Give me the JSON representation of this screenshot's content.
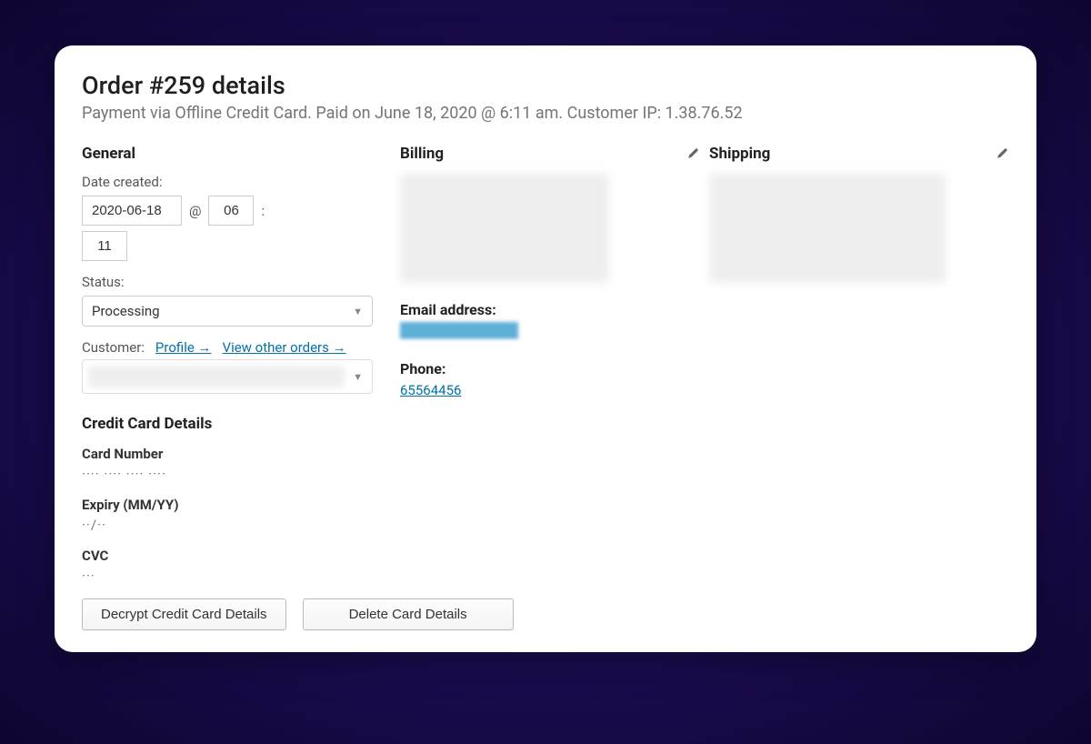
{
  "header": {
    "title": "Order #259 details",
    "subtitle": "Payment via Offline Credit Card. Paid on June 18, 2020 @ 6:11 am. Customer IP: 1.38.76.52"
  },
  "general": {
    "title": "General",
    "date_created_label": "Date created:",
    "date_value": "2020-06-18",
    "at_symbol": "@",
    "hour_value": "06",
    "colon": ":",
    "minute_value": "11",
    "status_label": "Status:",
    "status_value": "Processing",
    "customer_label": "Customer:",
    "profile_link": "Profile →",
    "view_orders_link": "View other orders →"
  },
  "billing": {
    "title": "Billing",
    "email_label": "Email address:",
    "phone_label": "Phone:",
    "phone_value": "65564456"
  },
  "shipping": {
    "title": "Shipping"
  },
  "credit_card": {
    "title": "Credit Card Details",
    "card_number_label": "Card Number",
    "card_number_value": "···· ···· ···· ····",
    "expiry_label": "Expiry (MM/YY)",
    "expiry_value": "··/··",
    "cvc_label": "CVC",
    "cvc_value": "···",
    "decrypt_button": "Decrypt Credit Card Details",
    "delete_button": "Delete Card Details"
  }
}
